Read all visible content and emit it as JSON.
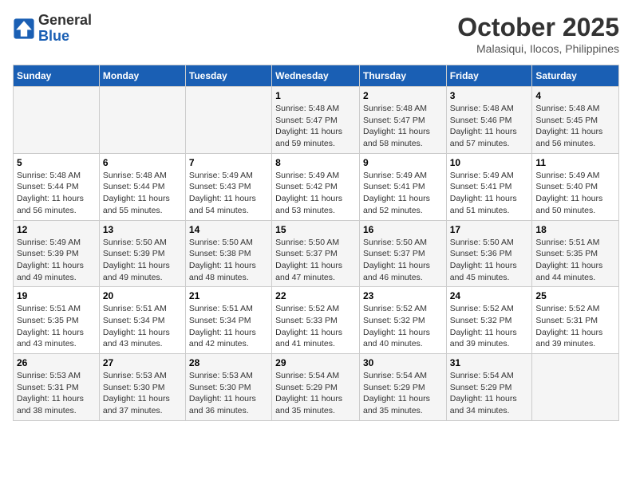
{
  "header": {
    "logo_line1": "General",
    "logo_line2": "Blue",
    "month": "October 2025",
    "location": "Malasiqui, Ilocos, Philippines"
  },
  "weekdays": [
    "Sunday",
    "Monday",
    "Tuesday",
    "Wednesday",
    "Thursday",
    "Friday",
    "Saturday"
  ],
  "weeks": [
    [
      {
        "day": "",
        "info": ""
      },
      {
        "day": "",
        "info": ""
      },
      {
        "day": "",
        "info": ""
      },
      {
        "day": "1",
        "info": "Sunrise: 5:48 AM\nSunset: 5:47 PM\nDaylight: 11 hours\nand 59 minutes."
      },
      {
        "day": "2",
        "info": "Sunrise: 5:48 AM\nSunset: 5:47 PM\nDaylight: 11 hours\nand 58 minutes."
      },
      {
        "day": "3",
        "info": "Sunrise: 5:48 AM\nSunset: 5:46 PM\nDaylight: 11 hours\nand 57 minutes."
      },
      {
        "day": "4",
        "info": "Sunrise: 5:48 AM\nSunset: 5:45 PM\nDaylight: 11 hours\nand 56 minutes."
      }
    ],
    [
      {
        "day": "5",
        "info": "Sunrise: 5:48 AM\nSunset: 5:44 PM\nDaylight: 11 hours\nand 56 minutes."
      },
      {
        "day": "6",
        "info": "Sunrise: 5:48 AM\nSunset: 5:44 PM\nDaylight: 11 hours\nand 55 minutes."
      },
      {
        "day": "7",
        "info": "Sunrise: 5:49 AM\nSunset: 5:43 PM\nDaylight: 11 hours\nand 54 minutes."
      },
      {
        "day": "8",
        "info": "Sunrise: 5:49 AM\nSunset: 5:42 PM\nDaylight: 11 hours\nand 53 minutes."
      },
      {
        "day": "9",
        "info": "Sunrise: 5:49 AM\nSunset: 5:41 PM\nDaylight: 11 hours\nand 52 minutes."
      },
      {
        "day": "10",
        "info": "Sunrise: 5:49 AM\nSunset: 5:41 PM\nDaylight: 11 hours\nand 51 minutes."
      },
      {
        "day": "11",
        "info": "Sunrise: 5:49 AM\nSunset: 5:40 PM\nDaylight: 11 hours\nand 50 minutes."
      }
    ],
    [
      {
        "day": "12",
        "info": "Sunrise: 5:49 AM\nSunset: 5:39 PM\nDaylight: 11 hours\nand 49 minutes."
      },
      {
        "day": "13",
        "info": "Sunrise: 5:50 AM\nSunset: 5:39 PM\nDaylight: 11 hours\nand 49 minutes."
      },
      {
        "day": "14",
        "info": "Sunrise: 5:50 AM\nSunset: 5:38 PM\nDaylight: 11 hours\nand 48 minutes."
      },
      {
        "day": "15",
        "info": "Sunrise: 5:50 AM\nSunset: 5:37 PM\nDaylight: 11 hours\nand 47 minutes."
      },
      {
        "day": "16",
        "info": "Sunrise: 5:50 AM\nSunset: 5:37 PM\nDaylight: 11 hours\nand 46 minutes."
      },
      {
        "day": "17",
        "info": "Sunrise: 5:50 AM\nSunset: 5:36 PM\nDaylight: 11 hours\nand 45 minutes."
      },
      {
        "day": "18",
        "info": "Sunrise: 5:51 AM\nSunset: 5:35 PM\nDaylight: 11 hours\nand 44 minutes."
      }
    ],
    [
      {
        "day": "19",
        "info": "Sunrise: 5:51 AM\nSunset: 5:35 PM\nDaylight: 11 hours\nand 43 minutes."
      },
      {
        "day": "20",
        "info": "Sunrise: 5:51 AM\nSunset: 5:34 PM\nDaylight: 11 hours\nand 43 minutes."
      },
      {
        "day": "21",
        "info": "Sunrise: 5:51 AM\nSunset: 5:34 PM\nDaylight: 11 hours\nand 42 minutes."
      },
      {
        "day": "22",
        "info": "Sunrise: 5:52 AM\nSunset: 5:33 PM\nDaylight: 11 hours\nand 41 minutes."
      },
      {
        "day": "23",
        "info": "Sunrise: 5:52 AM\nSunset: 5:32 PM\nDaylight: 11 hours\nand 40 minutes."
      },
      {
        "day": "24",
        "info": "Sunrise: 5:52 AM\nSunset: 5:32 PM\nDaylight: 11 hours\nand 39 minutes."
      },
      {
        "day": "25",
        "info": "Sunrise: 5:52 AM\nSunset: 5:31 PM\nDaylight: 11 hours\nand 39 minutes."
      }
    ],
    [
      {
        "day": "26",
        "info": "Sunrise: 5:53 AM\nSunset: 5:31 PM\nDaylight: 11 hours\nand 38 minutes."
      },
      {
        "day": "27",
        "info": "Sunrise: 5:53 AM\nSunset: 5:30 PM\nDaylight: 11 hours\nand 37 minutes."
      },
      {
        "day": "28",
        "info": "Sunrise: 5:53 AM\nSunset: 5:30 PM\nDaylight: 11 hours\nand 36 minutes."
      },
      {
        "day": "29",
        "info": "Sunrise: 5:54 AM\nSunset: 5:29 PM\nDaylight: 11 hours\nand 35 minutes."
      },
      {
        "day": "30",
        "info": "Sunrise: 5:54 AM\nSunset: 5:29 PM\nDaylight: 11 hours\nand 35 minutes."
      },
      {
        "day": "31",
        "info": "Sunrise: 5:54 AM\nSunset: 5:29 PM\nDaylight: 11 hours\nand 34 minutes."
      },
      {
        "day": "",
        "info": ""
      }
    ]
  ]
}
